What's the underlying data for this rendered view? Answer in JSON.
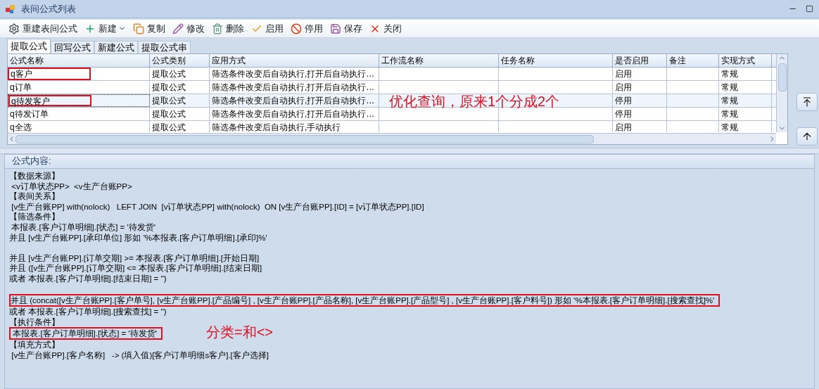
{
  "window": {
    "title": "表间公式列表"
  },
  "toolbar": [
    {
      "kind": "rebuild",
      "label": "重建表间公式"
    },
    {
      "kind": "new",
      "label": "新建",
      "has_menu": true
    },
    {
      "kind": "copy",
      "label": "复制"
    },
    {
      "kind": "edit",
      "label": "修改"
    },
    {
      "kind": "delete",
      "label": "删除"
    },
    {
      "kind": "enable",
      "label": "启用"
    },
    {
      "kind": "disable",
      "label": "停用"
    },
    {
      "kind": "save",
      "label": "保存"
    },
    {
      "kind": "close",
      "label": "关闭"
    }
  ],
  "tabs": [
    {
      "label": "提取公式",
      "selected": true
    },
    {
      "label": "回写公式",
      "selected": false
    },
    {
      "label": "新建公式",
      "selected": false
    },
    {
      "label": "提取公式串",
      "selected": false
    }
  ],
  "table": {
    "columns": [
      "公式名称",
      "公式类别",
      "应用方式",
      "工作流名称",
      "任务名称",
      "是否启用",
      "备注",
      "实现方式"
    ],
    "rows": [
      {
        "cells": [
          "q客户",
          "提取公式",
          "筛选条件改变后自动执行,打开后自动执行…",
          "",
          "",
          "启用",
          "",
          "常规"
        ],
        "selected": false,
        "highlighted": true
      },
      {
        "cells": [
          "q订单",
          "提取公式",
          "筛选条件改变后自动执行,打开后自动执行…",
          "",
          "",
          "启用",
          "",
          "常规"
        ],
        "selected": false,
        "highlighted": false
      },
      {
        "cells": [
          "q待发客户",
          "提取公式",
          "筛选条件改变后自动执行,打开后自动执行…",
          "",
          "",
          "停用",
          "",
          "常规"
        ],
        "selected": true,
        "highlighted": true
      },
      {
        "cells": [
          "q待发订单",
          "提取公式",
          "筛选条件改变后自动执行,打开后自动执行…",
          "",
          "",
          "停用",
          "",
          "常规"
        ],
        "selected": false,
        "highlighted": false
      },
      {
        "cells": [
          "q全选",
          "提取公式",
          "筛选条件改变后自动执行,手动执行",
          "",
          "",
          "启用",
          "",
          "常规"
        ],
        "selected": false,
        "highlighted": false
      }
    ]
  },
  "table_annotation": "优化查询，原来1个分成2个",
  "side_buttons": [
    {
      "kind": "top"
    },
    {
      "kind": "up"
    }
  ],
  "formula": {
    "label": "公式内容:",
    "paragraphs": [
      {
        "lines": [
          {
            "text": "【数据来源】",
            "highlighted": false
          },
          {
            "text": " <v订单状态PP>  <v生产台账PP>",
            "highlighted": false
          },
          {
            "text": "【表间关系】",
            "highlighted": false
          },
          {
            "text": " [v生产台账PP] with(nolock)   LEFT JOIN  [v订单状态PP] with(nolock)  ON [v生产台账PP].[ID] = [v订单状态PP].[ID]",
            "highlighted": false
          },
          {
            "text": "【筛选条件】",
            "highlighted": false
          },
          {
            "text": " 本报表.[客户订单明细].[状态] = '待发货'",
            "highlighted": false
          },
          {
            "text": "并且 [v生产台账PP].[承印单位] 形如 '%本报表.[客户订单明细].[承印]%'",
            "highlighted": false
          }
        ]
      },
      {
        "lines": [
          {
            "text": "并且 [v生产台账PP].[订单交期] >= 本报表.[客户订单明细].[开始日期]",
            "highlighted": false
          },
          {
            "text": "并且 ([v生产台账PP].[订单交期] <= 本报表.[客户订单明细].[结束日期]",
            "highlighted": false
          },
          {
            "text": "或者 本报表.[客户订单明细].[结束日期] = '')",
            "highlighted": false
          }
        ]
      },
      {
        "lines": [
          {
            "text": "并且 (concat([v生产台账PP].[客户单号], [v生产台账PP].[产品编号] , [v生产台账PP].[产品名称], [v生产台账PP].[产品型号] , [v生产台账PP].[客户料号]) 形如 '%本报表.[客户订单明细].[搜索查找]%'",
            "highlighted": true
          },
          {
            "text": "或者 本报表.[客户订单明细].[搜索查找] = '')",
            "highlighted": false
          },
          {
            "text": "【执行条件】",
            "highlighted": false
          },
          {
            "text": " 本报表.[客户订单明细].[状态] = '待发货'",
            "highlighted": true,
            "annotation": "分类=和<>"
          },
          {
            "text": "【填充方式】",
            "highlighted": false
          },
          {
            "text": " [v生产台账PP].[客户名称]   -> (填入值)[客户订单明细s客户].[客户选择]",
            "highlighted": false
          }
        ]
      }
    ]
  }
}
